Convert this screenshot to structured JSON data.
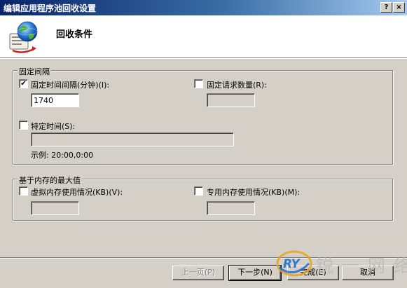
{
  "window": {
    "title": "编辑应用程序池回收设置",
    "help_button": "?",
    "close_button": "×"
  },
  "header": {
    "title": "回收条件",
    "icon": "app-pool-recycle-icon"
  },
  "fixed_intervals": {
    "legend": "固定间隔",
    "regular_time": {
      "label": "固定时间间隔(分钟)(I):",
      "checked": true,
      "value": "1740"
    },
    "request_limit": {
      "label": "固定请求数量(R):",
      "checked": false,
      "value": ""
    },
    "specific_time": {
      "label": "特定时间(S):",
      "checked": false,
      "value": "",
      "example": "示例: 20:00,0:00"
    }
  },
  "memory": {
    "legend": "基于内存的最大值",
    "virtual": {
      "label": "虚拟内存使用情况(KB)(V):",
      "checked": false,
      "value": ""
    },
    "private": {
      "label": "专用内存使用情况(KB)(M):",
      "checked": false,
      "value": ""
    }
  },
  "buttons": {
    "prev": "上一页(P)",
    "next": "下一步(N)",
    "finish": "完成(E)",
    "cancel": "取消"
  },
  "watermark": {
    "logo_text": "RY",
    "text": "锐 一 网 络"
  },
  "colors": {
    "title_gradient_start": "#0a246a",
    "title_gradient_end": "#a6caf0",
    "dialog_face": "#d4d0c8",
    "watermark_blue": "#1f6fd1",
    "watermark_gold": "#e8a317"
  }
}
